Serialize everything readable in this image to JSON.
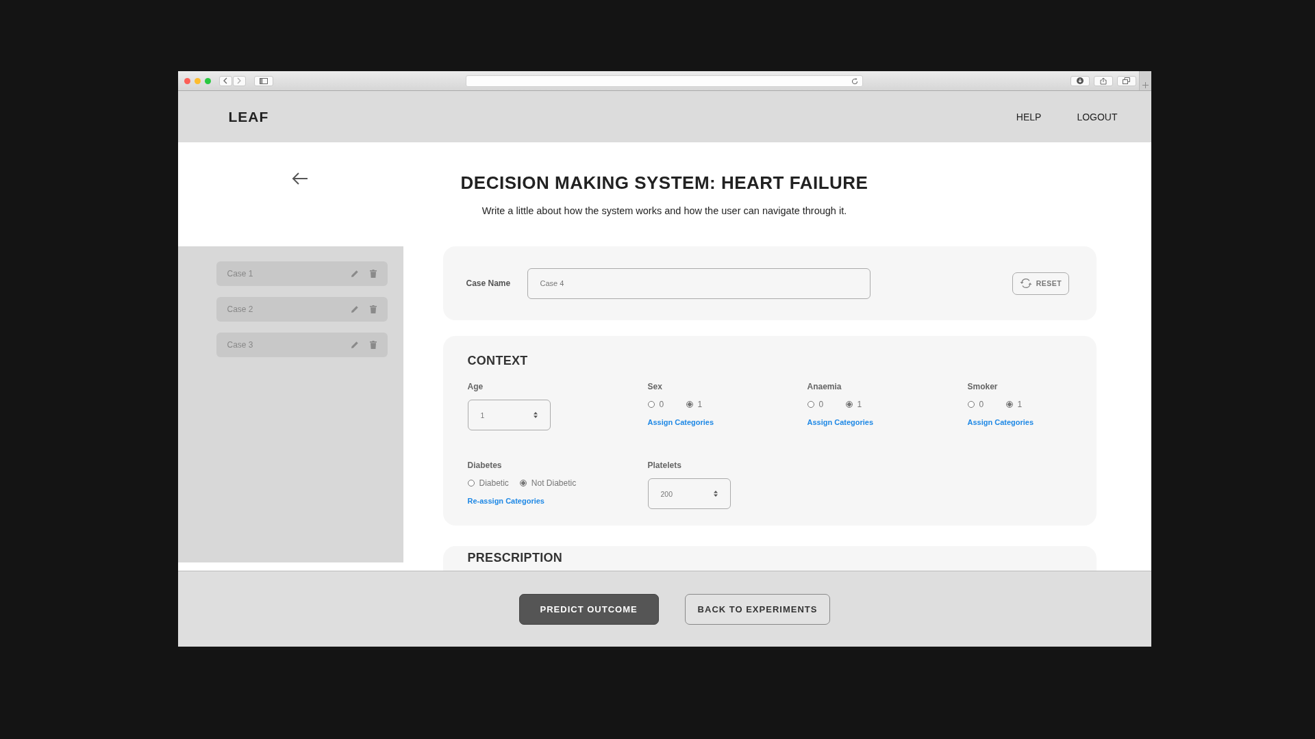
{
  "header": {
    "logo": "LEAF",
    "nav": [
      "HELP",
      "LOGOUT"
    ]
  },
  "page": {
    "title": "DECISION MAKING SYSTEM: HEART FAILURE",
    "description": "Write a little about how the system works and how the user can navigate through it."
  },
  "cases": [
    {
      "name": "Case 1"
    },
    {
      "name": "Case 2"
    },
    {
      "name": "Case 3"
    }
  ],
  "case_name": {
    "label": "Case Name",
    "value": "Case 4"
  },
  "reset": "RESET",
  "context": {
    "title": "CONTEXT",
    "fields": [
      {
        "kind": "stepper",
        "label": "Age",
        "value": "1"
      },
      {
        "kind": "radio",
        "label": "Sex",
        "options": [
          {
            "label": "0",
            "selected": false
          },
          {
            "label": "1",
            "selected": true
          }
        ],
        "link": "Assign Categories"
      },
      {
        "kind": "radio",
        "label": "Anaemia",
        "options": [
          {
            "label": "0",
            "selected": false
          },
          {
            "label": "1",
            "selected": true
          }
        ],
        "link": "Assign Categories"
      },
      {
        "kind": "radio",
        "label": "Smoker",
        "options": [
          {
            "label": "0",
            "selected": false
          },
          {
            "label": "1",
            "selected": true
          }
        ],
        "link": "Assign Categories"
      },
      {
        "kind": "radio",
        "label": "Diabetes",
        "options": [
          {
            "label": "Diabetic",
            "selected": false
          },
          {
            "label": "Not Diabetic",
            "selected": true
          }
        ],
        "link": "Re-assign Categories"
      },
      {
        "kind": "stepper",
        "label": "Platelets",
        "value": "200"
      }
    ]
  },
  "prescription": {
    "title": "PRESCRIPTION"
  },
  "actions": [
    {
      "label": "PREDICT OUTCOME",
      "primary": true
    },
    {
      "label": "BACK TO EXPERIMENTS",
      "primary": false
    }
  ]
}
